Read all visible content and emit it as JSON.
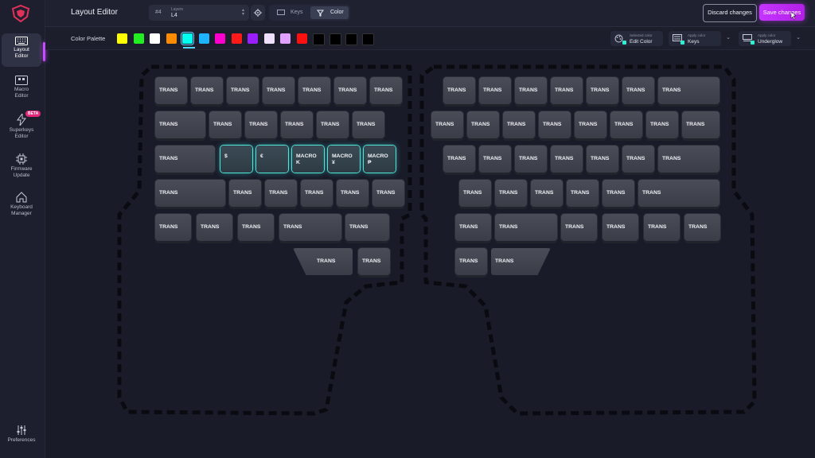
{
  "app": {
    "title": "Layout Editor"
  },
  "sidebar": {
    "items": [
      {
        "label": "Layout\nEditor",
        "icon": "keyboard-icon"
      },
      {
        "label": "Macro\nEditor",
        "icon": "macro-icon"
      },
      {
        "label": "Superkeys\nEditor",
        "icon": "lightning-icon",
        "badge": "BETA"
      },
      {
        "label": "Firmware\nUpdate",
        "icon": "chip-icon"
      },
      {
        "label": "Keyboard\nManager",
        "icon": "home-icon"
      }
    ],
    "preferences": "Preferences"
  },
  "header": {
    "layer_number": "#4",
    "layer_label": "Layers",
    "layer_value": "L4",
    "mode_keys": "Keys",
    "mode_color": "Color",
    "discard": "Discard changes",
    "save": "Save changes"
  },
  "palette": {
    "title": "Color Palette",
    "colors": [
      "#ffff00",
      "#22ee22",
      "#ffffff",
      "#ff8c00",
      "#00ffee",
      "#1eb4ff",
      "#ff00cc",
      "#ff1a1a",
      "#9a1eff",
      "#f0e0ff",
      "#e0a0ff",
      "#ff1010",
      "#000000",
      "#000000",
      "#000000",
      "#000000"
    ],
    "selected_index": 4,
    "selected_color_label": "Selected color",
    "selected_color_value": "Edit Color",
    "apply_keys_label": "Apply color",
    "apply_keys_value": "Keys",
    "apply_under_label": "Apply color",
    "apply_under_value": "Underglow"
  },
  "keyboard": {
    "left_rows": [
      [
        "TRANS",
        "TRANS",
        "TRANS",
        "TRANS",
        "TRANS",
        "TRANS",
        "TRANS"
      ],
      [
        "TRANS",
        "TRANS",
        "TRANS",
        "TRANS",
        "TRANS",
        "TRANS"
      ],
      [
        "TRANS",
        "$",
        "€",
        "MACRO\nK",
        "MACRO\n¥",
        "MACRO\n₱"
      ],
      [
        "TRANS",
        "TRANS",
        "TRANS",
        "TRANS",
        "TRANS",
        "TRANS"
      ],
      [
        "TRANS",
        "TRANS",
        "TRANS",
        "TRANS",
        "TRANS"
      ],
      [
        "TRANS",
        "TRANS"
      ]
    ],
    "right_rows": [
      [
        "TRANS",
        "TRANS",
        "TRANS",
        "TRANS",
        "TRANS",
        "TRANS",
        "TRANS"
      ],
      [
        "TRANS",
        "TRANS",
        "TRANS",
        "TRANS",
        "TRANS",
        "TRANS",
        "TRANS",
        "TRANS"
      ],
      [
        "TRANS",
        "TRANS",
        "TRANS",
        "TRANS",
        "TRANS",
        "TRANS",
        "TRANS"
      ],
      [
        "TRANS",
        "TRANS",
        "TRANS",
        "TRANS",
        "TRANS",
        "TRANS"
      ],
      [
        "TRANS",
        "TRANS",
        "TRANS",
        "TRANS",
        "TRANS",
        "TRANS"
      ],
      [
        "TRANS",
        "TRANS"
      ]
    ]
  }
}
